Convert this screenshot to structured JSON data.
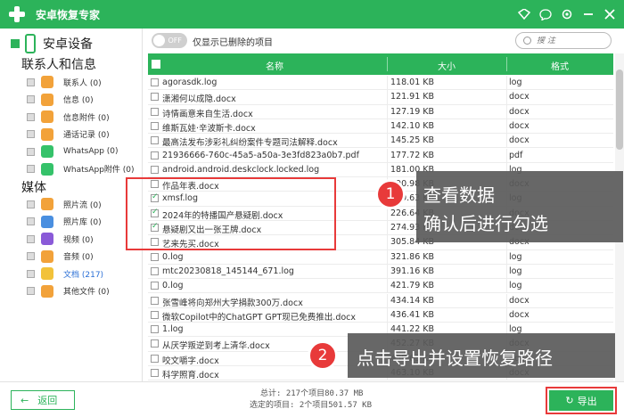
{
  "window": {
    "title": "安卓恢复专家",
    "controls": [
      "shield-icon",
      "chat-icon",
      "settings-icon",
      "minimize-icon",
      "close-icon"
    ]
  },
  "sidebar": {
    "device_label": "安卓设备",
    "section_contacts": "联系人和信息",
    "section_media": "媒体",
    "contacts_items": [
      {
        "label": "联系人 (0)",
        "icon": "contacts-icon",
        "color": "#f2a23a"
      },
      {
        "label": "信息 (0)",
        "icon": "message-icon",
        "color": "#f2a23a"
      },
      {
        "label": "信息附件 (0)",
        "icon": "attachment-icon",
        "color": "#f2a23a"
      },
      {
        "label": "通话记录 (0)",
        "icon": "phone-icon",
        "color": "#f2a23a"
      },
      {
        "label": "WhatsApp (0)",
        "icon": "whatsapp-icon",
        "color": "#35c26a"
      },
      {
        "label": "WhatsApp附件 (0)",
        "icon": "whatsapp-attachment-icon",
        "color": "#35c26a"
      }
    ],
    "media_items": [
      {
        "label": "照片流 (0)",
        "icon": "photo-stream-icon",
        "color": "#f2a23a"
      },
      {
        "label": "照片库 (0)",
        "icon": "photo-library-icon",
        "color": "#4a8fe0"
      },
      {
        "label": "视频 (0)",
        "icon": "video-icon",
        "color": "#8a5ad8"
      },
      {
        "label": "音频 (0)",
        "icon": "audio-icon",
        "color": "#f2a23a"
      },
      {
        "label": "文档 (217)",
        "icon": "document-icon",
        "color": "#f2c23a",
        "active": true
      },
      {
        "label": "其他文件 (0)",
        "icon": "other-file-icon",
        "color": "#f2a23a"
      }
    ]
  },
  "toolbar": {
    "toggle_text": "OFF",
    "toggle_label": "仅显示已删除的项目",
    "search_placeholder": "搜 注"
  },
  "table": {
    "headers": {
      "name": "名称",
      "size": "大小",
      "format": "格式"
    },
    "rows": [
      {
        "name": "agorasdk.log",
        "size": "118.01 KB",
        "format": "log",
        "checked": false
      },
      {
        "name": "潇湘何以成隐.docx",
        "size": "121.91 KB",
        "format": "docx",
        "checked": false
      },
      {
        "name": "诗情画意来自生活.docx",
        "size": "127.19 KB",
        "format": "docx",
        "checked": false
      },
      {
        "name": "维斯瓦娃·辛波斯卡.docx",
        "size": "142.10 KB",
        "format": "docx",
        "checked": false
      },
      {
        "name": "最高法发布涉彩礼纠纷案件专题司法解释.docx",
        "size": "145.25 KB",
        "format": "docx",
        "checked": false
      },
      {
        "name": "21936666-760c-45a5-a50a-3e3fd823a0b7.pdf",
        "size": "177.72 KB",
        "format": "pdf",
        "checked": false
      },
      {
        "name": "android.android.deskclock.locked.log",
        "size": "181.00 KB",
        "format": "log",
        "checked": false
      },
      {
        "name": "作品年表.docx",
        "size": "190.98 KB",
        "format": "docx",
        "checked": false
      },
      {
        "name": "xmsf.log",
        "size": "219.63 KB",
        "format": "log",
        "checked": true
      },
      {
        "name": "2024年的特播国产悬疑剧.docx",
        "size": "226.64 KB",
        "format": "docx",
        "checked": true
      },
      {
        "name": "悬疑剧又出一张王牌.docx",
        "size": "274.93 KB",
        "format": "docx",
        "checked": true
      },
      {
        "name": "艺来先买.docx",
        "size": "305.84 KB",
        "format": "docx",
        "checked": false
      },
      {
        "name": "0.log",
        "size": "321.86 KB",
        "format": "log",
        "checked": false
      },
      {
        "name": "mtc20230818_145144_671.log",
        "size": "391.16 KB",
        "format": "log",
        "checked": false
      },
      {
        "name": "0.log",
        "size": "421.79 KB",
        "format": "log",
        "checked": false
      },
      {
        "name": "张雪峰将向郑州大学捐款300万.docx",
        "size": "434.14 KB",
        "format": "docx",
        "checked": false
      },
      {
        "name": "微软Copilot中的ChatGPT GPT现已免费推出.docx",
        "size": "436.41 KB",
        "format": "docx",
        "checked": false
      },
      {
        "name": "1.log",
        "size": "441.22 KB",
        "format": "log",
        "checked": false
      },
      {
        "name": "从厌学叛逆到考上清华.docx",
        "size": "452.27 KB",
        "format": "docx",
        "checked": false
      },
      {
        "name": "咬文嚼字.docx",
        "size": "458.63 KB",
        "format": "docx",
        "checked": false
      },
      {
        "name": "科学照育.docx",
        "size": "463.10 KB",
        "format": "docx",
        "checked": false
      }
    ]
  },
  "callouts": {
    "step1_number": "1",
    "step1_line1": "查看数据",
    "step1_line2": "确认后进行勾选",
    "step2_number": "2",
    "step2_text": "点击导出并设置恢复路径"
  },
  "footer": {
    "back_label": "返回",
    "total_text": "总计: 217个项目80.37 MB",
    "selected_text": "选定的项目: 2个项目501.57 KB",
    "export_label": "导出"
  },
  "colors": {
    "accent": "#2cb35a",
    "highlight": "#e83a3a"
  }
}
